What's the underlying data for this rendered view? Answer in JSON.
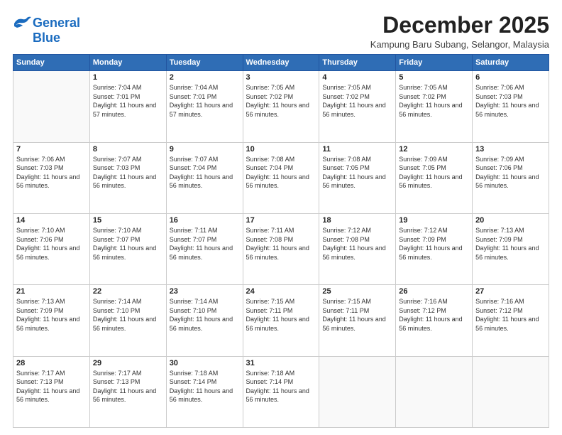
{
  "logo": {
    "line1": "General",
    "line2": "Blue"
  },
  "title": "December 2025",
  "subtitle": "Kampung Baru Subang, Selangor, Malaysia",
  "weekdays": [
    "Sunday",
    "Monday",
    "Tuesday",
    "Wednesday",
    "Thursday",
    "Friday",
    "Saturday"
  ],
  "weeks": [
    [
      {
        "day": "",
        "sunrise": "",
        "sunset": "",
        "daylight": ""
      },
      {
        "day": "1",
        "sunrise": "Sunrise: 7:04 AM",
        "sunset": "Sunset: 7:01 PM",
        "daylight": "Daylight: 11 hours and 57 minutes."
      },
      {
        "day": "2",
        "sunrise": "Sunrise: 7:04 AM",
        "sunset": "Sunset: 7:01 PM",
        "daylight": "Daylight: 11 hours and 57 minutes."
      },
      {
        "day": "3",
        "sunrise": "Sunrise: 7:05 AM",
        "sunset": "Sunset: 7:02 PM",
        "daylight": "Daylight: 11 hours and 56 minutes."
      },
      {
        "day": "4",
        "sunrise": "Sunrise: 7:05 AM",
        "sunset": "Sunset: 7:02 PM",
        "daylight": "Daylight: 11 hours and 56 minutes."
      },
      {
        "day": "5",
        "sunrise": "Sunrise: 7:05 AM",
        "sunset": "Sunset: 7:02 PM",
        "daylight": "Daylight: 11 hours and 56 minutes."
      },
      {
        "day": "6",
        "sunrise": "Sunrise: 7:06 AM",
        "sunset": "Sunset: 7:03 PM",
        "daylight": "Daylight: 11 hours and 56 minutes."
      }
    ],
    [
      {
        "day": "7",
        "sunrise": "Sunrise: 7:06 AM",
        "sunset": "Sunset: 7:03 PM",
        "daylight": "Daylight: 11 hours and 56 minutes."
      },
      {
        "day": "8",
        "sunrise": "Sunrise: 7:07 AM",
        "sunset": "Sunset: 7:03 PM",
        "daylight": "Daylight: 11 hours and 56 minutes."
      },
      {
        "day": "9",
        "sunrise": "Sunrise: 7:07 AM",
        "sunset": "Sunset: 7:04 PM",
        "daylight": "Daylight: 11 hours and 56 minutes."
      },
      {
        "day": "10",
        "sunrise": "Sunrise: 7:08 AM",
        "sunset": "Sunset: 7:04 PM",
        "daylight": "Daylight: 11 hours and 56 minutes."
      },
      {
        "day": "11",
        "sunrise": "Sunrise: 7:08 AM",
        "sunset": "Sunset: 7:05 PM",
        "daylight": "Daylight: 11 hours and 56 minutes."
      },
      {
        "day": "12",
        "sunrise": "Sunrise: 7:09 AM",
        "sunset": "Sunset: 7:05 PM",
        "daylight": "Daylight: 11 hours and 56 minutes."
      },
      {
        "day": "13",
        "sunrise": "Sunrise: 7:09 AM",
        "sunset": "Sunset: 7:06 PM",
        "daylight": "Daylight: 11 hours and 56 minutes."
      }
    ],
    [
      {
        "day": "14",
        "sunrise": "Sunrise: 7:10 AM",
        "sunset": "Sunset: 7:06 PM",
        "daylight": "Daylight: 11 hours and 56 minutes."
      },
      {
        "day": "15",
        "sunrise": "Sunrise: 7:10 AM",
        "sunset": "Sunset: 7:07 PM",
        "daylight": "Daylight: 11 hours and 56 minutes."
      },
      {
        "day": "16",
        "sunrise": "Sunrise: 7:11 AM",
        "sunset": "Sunset: 7:07 PM",
        "daylight": "Daylight: 11 hours and 56 minutes."
      },
      {
        "day": "17",
        "sunrise": "Sunrise: 7:11 AM",
        "sunset": "Sunset: 7:08 PM",
        "daylight": "Daylight: 11 hours and 56 minutes."
      },
      {
        "day": "18",
        "sunrise": "Sunrise: 7:12 AM",
        "sunset": "Sunset: 7:08 PM",
        "daylight": "Daylight: 11 hours and 56 minutes."
      },
      {
        "day": "19",
        "sunrise": "Sunrise: 7:12 AM",
        "sunset": "Sunset: 7:09 PM",
        "daylight": "Daylight: 11 hours and 56 minutes."
      },
      {
        "day": "20",
        "sunrise": "Sunrise: 7:13 AM",
        "sunset": "Sunset: 7:09 PM",
        "daylight": "Daylight: 11 hours and 56 minutes."
      }
    ],
    [
      {
        "day": "21",
        "sunrise": "Sunrise: 7:13 AM",
        "sunset": "Sunset: 7:09 PM",
        "daylight": "Daylight: 11 hours and 56 minutes."
      },
      {
        "day": "22",
        "sunrise": "Sunrise: 7:14 AM",
        "sunset": "Sunset: 7:10 PM",
        "daylight": "Daylight: 11 hours and 56 minutes."
      },
      {
        "day": "23",
        "sunrise": "Sunrise: 7:14 AM",
        "sunset": "Sunset: 7:10 PM",
        "daylight": "Daylight: 11 hours and 56 minutes."
      },
      {
        "day": "24",
        "sunrise": "Sunrise: 7:15 AM",
        "sunset": "Sunset: 7:11 PM",
        "daylight": "Daylight: 11 hours and 56 minutes."
      },
      {
        "day": "25",
        "sunrise": "Sunrise: 7:15 AM",
        "sunset": "Sunset: 7:11 PM",
        "daylight": "Daylight: 11 hours and 56 minutes."
      },
      {
        "day": "26",
        "sunrise": "Sunrise: 7:16 AM",
        "sunset": "Sunset: 7:12 PM",
        "daylight": "Daylight: 11 hours and 56 minutes."
      },
      {
        "day": "27",
        "sunrise": "Sunrise: 7:16 AM",
        "sunset": "Sunset: 7:12 PM",
        "daylight": "Daylight: 11 hours and 56 minutes."
      }
    ],
    [
      {
        "day": "28",
        "sunrise": "Sunrise: 7:17 AM",
        "sunset": "Sunset: 7:13 PM",
        "daylight": "Daylight: 11 hours and 56 minutes."
      },
      {
        "day": "29",
        "sunrise": "Sunrise: 7:17 AM",
        "sunset": "Sunset: 7:13 PM",
        "daylight": "Daylight: 11 hours and 56 minutes."
      },
      {
        "day": "30",
        "sunrise": "Sunrise: 7:18 AM",
        "sunset": "Sunset: 7:14 PM",
        "daylight": "Daylight: 11 hours and 56 minutes."
      },
      {
        "day": "31",
        "sunrise": "Sunrise: 7:18 AM",
        "sunset": "Sunset: 7:14 PM",
        "daylight": "Daylight: 11 hours and 56 minutes."
      },
      {
        "day": "",
        "sunrise": "",
        "sunset": "",
        "daylight": ""
      },
      {
        "day": "",
        "sunrise": "",
        "sunset": "",
        "daylight": ""
      },
      {
        "day": "",
        "sunrise": "",
        "sunset": "",
        "daylight": ""
      }
    ]
  ]
}
